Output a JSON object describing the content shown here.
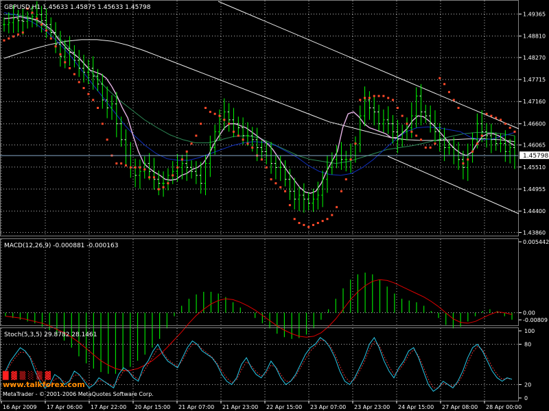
{
  "app": {
    "watermark": "MetaTrader - © 2001-2006 MetaQuotes Software Corp.",
    "logo_text": "www.talkforex.com"
  },
  "colors": {
    "background": "#000000",
    "grid": "#c0c0c0",
    "bull_bar": "#00ff00",
    "bear_bar": "#ffffff",
    "parabolic_sar": "#ff4a2a",
    "ma_fast": "#e6b4e6",
    "ma_mid": "#1030c0",
    "ma_slow": "#2e8b57",
    "ma_long": "#f0f0f0",
    "channel": "#f0f0f0",
    "macd_hist": "#00e000",
    "macd_signal": "#e00000",
    "stoch_main": "#28c8e8",
    "stoch_signal": "#e03030",
    "current_price_line": "#87a8c8"
  },
  "chart_data": [
    {
      "type": "line",
      "panel": "price",
      "title": "GBPUSD,H1 1.45633 1.45875 1.45633 1.45798",
      "symbol": "GBPUSD",
      "timeframe": "H1",
      "ohlc_last": [
        1.45633,
        1.45875,
        1.45633,
        1.45798
      ],
      "current_price_label": "1.45798",
      "current_price": 1.45798,
      "ylim": [
        1.4385,
        1.4965
      ],
      "y_ticks": [
        "1.49365",
        "1.48810",
        "1.48270",
        "1.47715",
        "1.47160",
        "1.46600",
        "1.46065",
        "1.45510",
        "1.44955",
        "1.44400",
        "1.43860"
      ],
      "x_ticks": [
        "16 Apr 2009",
        "17 Apr 06:00",
        "17 Apr 22:00",
        "20 Apr 15:00",
        "21 Apr 07:00",
        "21 Apr 23:00",
        "22 Apr 15:00",
        "23 Apr 07:00",
        "23 Apr 23:00",
        "24 Apr 15:00",
        "27 Apr 08:00",
        "28 Apr 00:00"
      ],
      "grid": true,
      "series": [
        {
          "kind": "close",
          "points": [
            1.491,
            1.4915,
            1.4925,
            1.492,
            1.4918,
            1.4925,
            1.493,
            1.4935,
            1.492,
            1.491,
            1.489,
            1.486,
            1.483,
            1.485,
            1.484,
            1.482,
            1.48,
            1.479,
            1.48,
            1.478,
            1.476,
            1.472,
            1.47,
            1.471,
            1.466,
            1.462,
            1.458,
            1.455,
            1.453,
            1.454,
            1.456,
            1.454,
            1.452,
            1.451,
            1.451,
            1.453,
            1.454,
            1.455,
            1.456,
            1.455,
            1.454,
            1.453,
            1.451,
            1.456,
            1.46,
            1.464,
            1.467,
            1.469,
            1.467,
            1.466,
            1.465,
            1.463,
            1.463,
            1.462,
            1.46,
            1.459,
            1.458,
            1.456,
            1.455,
            1.455,
            1.452,
            1.449,
            1.447,
            1.448,
            1.447,
            1.446,
            1.447,
            1.448,
            1.452,
            1.455,
            1.457,
            1.458,
            1.457,
            1.457,
            1.458,
            1.461,
            1.468,
            1.472,
            1.47,
            1.469,
            1.466,
            1.467,
            1.466,
            1.464,
            1.462,
            1.464,
            1.465,
            1.468,
            1.473,
            1.469,
            1.468,
            1.466,
            1.464,
            1.462,
            1.46,
            1.46,
            1.458,
            1.457,
            1.455,
            1.458,
            1.462,
            1.466,
            1.464,
            1.463,
            1.462,
            1.461,
            1.461,
            1.459,
            1.46,
            1.458
          ]
        },
        {
          "kind": "parabolic_sar",
          "points": [
            1.487,
            1.4875,
            1.488,
            1.4885,
            1.489,
            1.495,
            1.494,
            1.4925,
            1.491,
            1.4895,
            1.4875,
            1.4855,
            1.4835,
            1.4815,
            1.48,
            1.4785,
            1.4765,
            1.475,
            1.4735,
            1.472,
            1.47,
            1.466,
            1.462,
            1.458,
            1.456,
            1.456,
            1.4555,
            1.455,
            1.455,
            1.455,
            1.4545,
            1.4525,
            1.4525,
            1.4495,
            1.45,
            1.451,
            1.453,
            1.455,
            1.457,
            1.459,
            1.461,
            1.463,
            1.466,
            1.47,
            1.469,
            1.4685,
            1.468,
            1.467,
            1.466,
            1.464,
            1.463,
            1.462,
            1.461,
            1.46,
            1.458,
            1.457,
            1.455,
            1.452,
            1.451,
            1.45,
            1.449,
            1.4455,
            1.442,
            1.441,
            1.4405,
            1.44,
            1.4405,
            1.441,
            1.4415,
            1.442,
            1.443,
            1.445,
            1.449,
            1.452,
            1.457,
            1.461,
            1.472,
            1.4725,
            1.4725,
            1.473,
            1.473,
            1.473,
            1.4725,
            1.472,
            1.47,
            1.468,
            1.466,
            1.464,
            1.463,
            1.462,
            1.46,
            1.46,
            1.461,
            1.4775,
            1.476,
            1.474,
            1.472,
            1.47,
            1.456,
            1.457,
            1.459,
            1.461,
            1.463,
            1.4685,
            1.468,
            1.4675,
            1.467,
            1.466,
            1.465,
            1.464
          ]
        },
        {
          "kind": "ma_fast",
          "points": [
            1.4925,
            1.4926,
            1.4928,
            1.493,
            1.4927,
            1.4925,
            1.4922,
            1.4915,
            1.4905,
            1.4895,
            1.4875,
            1.486,
            1.4845,
            1.4835,
            1.4825,
            1.481,
            1.4795,
            1.479,
            1.4785,
            1.4775,
            1.4755,
            1.473,
            1.47,
            1.4675,
            1.463,
            1.459,
            1.456,
            1.4548,
            1.4538,
            1.453,
            1.452,
            1.4518,
            1.452,
            1.453,
            1.4535,
            1.4545,
            1.455,
            1.456,
            1.458,
            1.4608,
            1.463,
            1.465,
            1.466,
            1.466,
            1.4655,
            1.465,
            1.464,
            1.463,
            1.462,
            1.461,
            1.4595,
            1.4575,
            1.4555,
            1.4535,
            1.4518,
            1.45,
            1.4488,
            1.4485,
            1.449,
            1.451,
            1.454,
            1.4565,
            1.459,
            1.465,
            1.4685,
            1.469,
            1.4678,
            1.466,
            1.465,
            1.4645,
            1.464,
            1.4635,
            1.4625,
            1.4625,
            1.4635,
            1.4648,
            1.4668,
            1.468,
            1.4678,
            1.4668,
            1.4655,
            1.464,
            1.4625,
            1.4608,
            1.4595,
            1.4585,
            1.458,
            1.4588,
            1.461,
            1.4628,
            1.4635,
            1.4635,
            1.463,
            1.4622,
            1.4613,
            1.4605
          ]
        },
        {
          "kind": "ma_mid",
          "points": [
            1.494,
            1.4935,
            1.4925,
            1.491,
            1.489,
            1.4865,
            1.4835,
            1.48,
            1.4765,
            1.473,
            1.4695,
            1.466,
            1.463,
            1.4605,
            1.4585,
            1.4572,
            1.4568,
            1.4568,
            1.4575,
            1.4585,
            1.4595,
            1.4605,
            1.4612,
            1.4615,
            1.4613,
            1.4605,
            1.459,
            1.4575,
            1.4555,
            1.454,
            1.4532,
            1.453,
            1.4535,
            1.455,
            1.457,
            1.4595,
            1.462,
            1.464,
            1.465,
            1.4652,
            1.465,
            1.4645,
            1.464,
            1.4625,
            1.462,
            1.4622,
            1.463,
            1.4638
          ]
        },
        {
          "kind": "ma_slow",
          "points": [
            1.4935,
            1.4935,
            1.4928,
            1.491,
            1.4885,
            1.4855,
            1.482,
            1.4785,
            1.475,
            1.472,
            1.4695,
            1.467,
            1.465,
            1.4632,
            1.462,
            1.4612,
            1.4612,
            1.462,
            1.4628,
            1.463,
            1.4625,
            1.461,
            1.4595,
            1.458,
            1.457,
            1.4565,
            1.456,
            1.4565,
            1.4575,
            1.4585,
            1.4595,
            1.46,
            1.4605,
            1.4612,
            1.462,
            1.4628,
            1.4635,
            1.4638,
            1.4638,
            1.4635,
            1.463
          ]
        },
        {
          "kind": "ma_long",
          "points": [
            1.4825,
            1.4838,
            1.485,
            1.486,
            1.4868,
            1.4872,
            1.4872,
            1.4868,
            1.4858,
            1.4845,
            1.483,
            1.4815,
            1.48,
            1.4785,
            1.477,
            1.4755,
            1.474,
            1.4725,
            1.471,
            1.4695,
            1.468,
            1.4665,
            1.4655,
            1.4645,
            1.4635,
            1.4625,
            1.462,
            1.4618,
            1.4618,
            1.462,
            1.4622,
            1.4622,
            1.462,
            1.4615
          ]
        }
      ]
    },
    {
      "type": "bar",
      "panel": "macd",
      "title": "MACD(12,26,9) -0.000881 -0.000163",
      "ylim": [
        -0.000856,
        0.005442
      ],
      "y_ticks": [
        "0.005442",
        "0.00",
        "-0.00809"
      ],
      "grid": true,
      "series": [
        {
          "name": "MACD",
          "kind": "histogram",
          "values": [
            -0.0004,
            -0.0006,
            -0.0008,
            -0.001,
            -0.0012,
            -0.0016,
            -0.002,
            -0.0026,
            -0.0032,
            -0.004,
            -0.005,
            -0.0058,
            -0.0064,
            -0.0068,
            -0.007,
            -0.007,
            -0.0067,
            -0.0062,
            -0.0055,
            -0.0048,
            -0.004,
            -0.003,
            -0.0018,
            -0.0004,
            0.0008,
            0.0016,
            0.0021,
            0.0024,
            0.0024,
            0.0022,
            0.0018,
            0.0012,
            0.0006,
            0.0,
            -0.0006,
            -0.0012,
            -0.0018,
            -0.0024,
            -0.0028,
            -0.003,
            -0.0029,
            -0.0025,
            -0.0018,
            -0.0008,
            0.0004,
            0.0016,
            0.0028,
            0.0038,
            0.0044,
            0.0046,
            0.0044,
            0.0038,
            0.003,
            0.0022,
            0.0016,
            0.0014,
            0.0012,
            0.0008,
            0.0002,
            -0.0006,
            -0.0014,
            -0.0018,
            -0.0016,
            -0.001,
            -0.0004,
            0.0002,
            0.0004,
            0.0002,
            -0.0004,
            -0.0008
          ]
        },
        {
          "name": "Signal",
          "kind": "line",
          "values": [
            -0.0004,
            -0.0005,
            -0.0006,
            -0.0008,
            -0.001,
            -0.0012,
            -0.0015,
            -0.0019,
            -0.0023,
            -0.0028,
            -0.0034,
            -0.0041,
            -0.0048,
            -0.0055,
            -0.006,
            -0.0064,
            -0.0066,
            -0.0066,
            -0.0064,
            -0.006,
            -0.0055,
            -0.0048,
            -0.004,
            -0.0031,
            -0.0022,
            -0.0012,
            -0.0003,
            0.0004,
            0.001,
            0.0014,
            0.0016,
            0.0015,
            0.0012,
            0.0008,
            0.0003,
            -0.0003,
            -0.0009,
            -0.0015,
            -0.002,
            -0.0024,
            -0.0027,
            -0.0028,
            -0.0027,
            -0.0023,
            -0.0016,
            -0.0007,
            0.0004,
            0.0015,
            0.0024,
            0.0031,
            0.0036,
            0.0038,
            0.0037,
            0.0034,
            0.003,
            0.0026,
            0.0022,
            0.0018,
            0.0013,
            0.0007,
            0.0,
            -0.0007,
            -0.0011,
            -0.0012,
            -0.001,
            -0.0006,
            -0.0002,
            0.0001,
            0.0,
            -0.0002
          ]
        }
      ]
    },
    {
      "type": "line",
      "panel": "stochastic",
      "title": "Stoch(5,3,5) 29.8782 28.1461",
      "ylim": [
        0,
        100
      ],
      "y_ticks": [
        "100",
        "80",
        "20",
        "0"
      ],
      "grid": true,
      "series": [
        {
          "name": "Main",
          "values": [
            40,
            55,
            65,
            75,
            70,
            60,
            40,
            25,
            15,
            20,
            35,
            30,
            20,
            25,
            40,
            35,
            25,
            15,
            20,
            30,
            25,
            20,
            15,
            35,
            45,
            40,
            30,
            25,
            45,
            55,
            70,
            80,
            65,
            55,
            50,
            45,
            60,
            75,
            85,
            80,
            70,
            65,
            60,
            50,
            35,
            25,
            20,
            30,
            50,
            60,
            45,
            35,
            30,
            40,
            55,
            45,
            30,
            20,
            25,
            35,
            50,
            65,
            75,
            80,
            90,
            85,
            75,
            60,
            40,
            25,
            20,
            30,
            45,
            60,
            80,
            90,
            75,
            55,
            40,
            30,
            45,
            55,
            70,
            75,
            60,
            40,
            20,
            10,
            15,
            25,
            20,
            15,
            25,
            40,
            60,
            75,
            80,
            70,
            55,
            40,
            30,
            25,
            30,
            28
          ]
        },
        {
          "name": "Signal",
          "values": [
            38,
            50,
            60,
            68,
            68,
            62,
            48,
            32,
            20,
            18,
            28,
            30,
            24,
            24,
            34,
            34,
            28,
            20,
            20,
            26,
            25,
            21,
            18,
            28,
            40,
            40,
            33,
            28,
            38,
            50,
            62,
            74,
            68,
            58,
            52,
            47,
            56,
            70,
            80,
            80,
            73,
            67,
            61,
            52,
            40,
            30,
            23,
            27,
            42,
            54,
            48,
            39,
            33,
            37,
            49,
            46,
            35,
            25,
            25,
            32,
            45,
            58,
            70,
            77,
            86,
            85,
            78,
            65,
            48,
            32,
            24,
            27,
            40,
            54,
            72,
            84,
            78,
            62,
            47,
            35,
            41,
            51,
            64,
            72,
            63,
            46,
            28,
            15,
            15,
            22,
            20,
            17,
            22,
            34,
            52,
            68,
            77,
            72,
            60,
            46,
            35,
            28,
            29,
            28
          ]
        }
      ]
    }
  ]
}
